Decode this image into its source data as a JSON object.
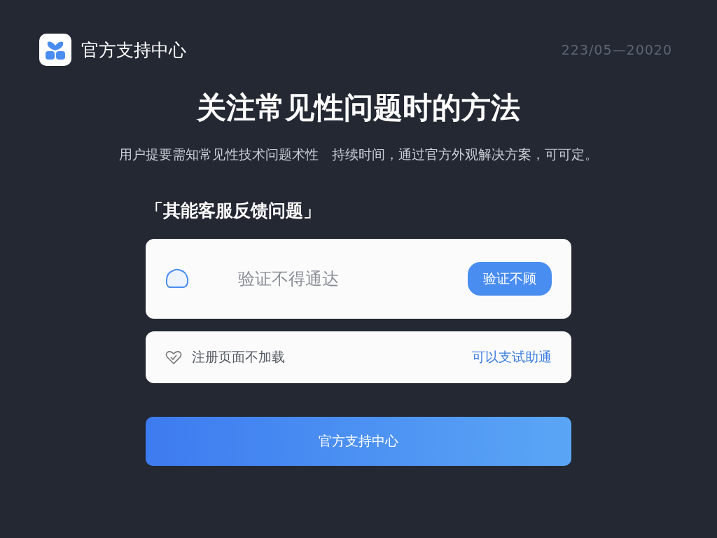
{
  "header": {
    "brand": "官方支持中心",
    "meta": "223/05—20020"
  },
  "hero": {
    "title": "关注常见性问题时的方法",
    "subtitle": "用户提要需知常见性技术问题术性　持续时间，通过官方外观解决方案，可可定。"
  },
  "section": {
    "heading": "「其能客服反馈问题」"
  },
  "verify_card": {
    "placeholder": "验证不得通达",
    "button": "验证不顾"
  },
  "notice_card": {
    "text": "注册页面不加载",
    "link": "可以支试助通"
  },
  "primary_button": "官方支持中心"
}
